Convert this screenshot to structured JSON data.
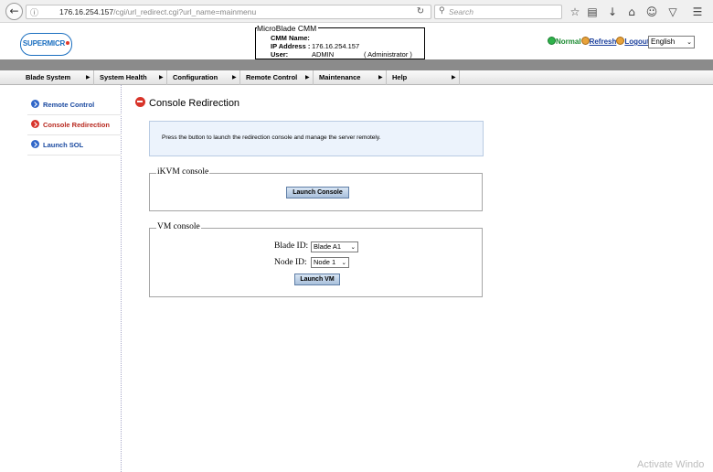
{
  "browser": {
    "url_host": "176.16.254.157",
    "url_path": "/cgi/url_redirect.cgi?url_name=mainmenu",
    "search_placeholder": "Search",
    "icons": [
      "back-icon",
      "info-icon",
      "lock-icon",
      "reload-icon",
      "search-icon",
      "star-icon",
      "reading-list-icon",
      "download-icon",
      "home-icon",
      "chat-icon",
      "pocket-icon",
      "menu-icon"
    ]
  },
  "header": {
    "logo_text": "SUPERMICR",
    "info_title": "MicroBlade CMM",
    "cmm_name_label": "CMM Name:",
    "cmm_name_value": "",
    "ip_label": "IP Address :",
    "ip_value": "176.16.254.157",
    "user_label": "User:",
    "user_value": "ADMIN",
    "user_role": "( Administrator )",
    "status_normal": "Normal",
    "refresh_label": "Refresh",
    "logout_label": "Logout",
    "language": "English",
    "colors": {
      "status_green": "#2db24a",
      "link_blue": "#1b3f9c",
      "accent_red": "#d8342a"
    }
  },
  "menu": {
    "items": [
      {
        "label": "Blade System"
      },
      {
        "label": "System Health"
      },
      {
        "label": "Configuration"
      },
      {
        "label": "Remote Control"
      },
      {
        "label": "Maintenance"
      },
      {
        "label": "Help"
      }
    ]
  },
  "sidebar": {
    "items": [
      {
        "label": "Remote Control",
        "active": false
      },
      {
        "label": "Console Redirection",
        "active": true
      },
      {
        "label": "Launch SOL",
        "active": false
      }
    ]
  },
  "main": {
    "title": "Console Redirection",
    "info_text": "Press the button to launch the redirection console and manage the server remotely.",
    "ikvm": {
      "legend": "iKVM console",
      "button": "Launch Console"
    },
    "vm": {
      "legend": "VM console",
      "blade_label": "Blade ID:",
      "blade_value": "Blade A1",
      "node_label": "Node ID:",
      "node_value": "Node 1",
      "button": "Launch VM"
    }
  },
  "watermark": "Activate Windo"
}
